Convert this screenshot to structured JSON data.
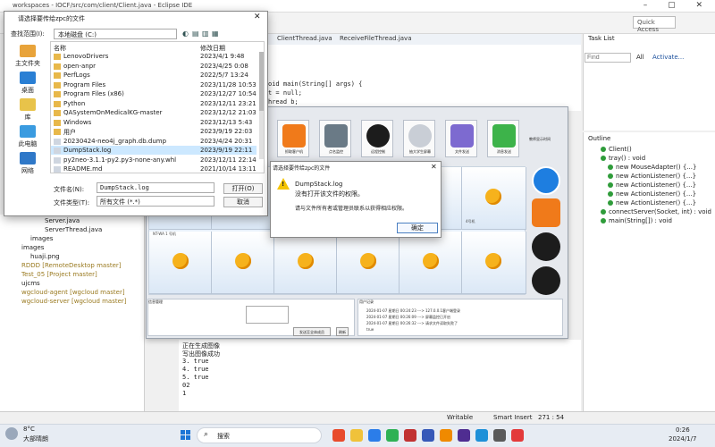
{
  "eclipse": {
    "title": "workspaces - IOCF/src/com/client/Client.java - Eclipse IDE",
    "quick_access": "Quick Access",
    "tabs": [
      "ClientThread.java",
      "ReceiveFileThread.java"
    ],
    "code_lines": [
      "oid main(String[] args) {",
      "t = null;",
      "hread b;"
    ],
    "task_list_title": "Task List",
    "find_placeholder": "Find",
    "find_all": "All",
    "find_activate": "Activate...",
    "outline_title": "Outline",
    "outline_items": [
      "Client()",
      "tray() : void",
      "new MouseAdapter() {...}",
      "new ActionListener() {...}",
      "new ActionListener() {...}",
      "new ActionListener() {...}",
      "new ActionListener() {...}",
      "connectServer(Socket, int) : void",
      "main(String[]) : void"
    ],
    "explorer_items": [
      "Server.java",
      "ServerThread.java",
      "images",
      "images",
      "huaji.png",
      "RDDD [RemoteDesktop master]",
      "Test_05 [Project master]",
      "ujcms",
      "wgcloud-agent [wgcloud master]",
      "wgcloud-server [wgcloud master]"
    ],
    "console_lines": [
      "正在生成图像",
      "写出图像成功",
      "3. true",
      "4. true",
      "5. true",
      "02",
      "1"
    ],
    "status": {
      "writable": "Writable",
      "insert": "Smart Insert",
      "position": "271 : 54"
    }
  },
  "remote_app": {
    "toolbar": [
      "抓取客户机",
      "点名监控",
      "远程控制",
      "抽大学生屏幕",
      "文件发送",
      "消息发送"
    ],
    "side_label": "教师显示时间",
    "cell_label": "NT-WA 1 号机",
    "cell_label_2": "4号机",
    "info_title": "信息管理",
    "notify_button": "发送至全体成员",
    "send_label": "刷新",
    "log_title": "用户记录",
    "log_lines": [
      "2024-01-07 星期日 00:24:23 ---> 127.0.0.1客户端登录",
      "2024-01-07 星期日 00:26:09 ---> 屏幕监控已开启",
      "2024-01-07 星期日 00:26:32 ---> 请求文件读取失败了",
      "true"
    ]
  },
  "file_dialog": {
    "title": "请选择要传给zpc的文件",
    "look_in_label": "查找范围(I):",
    "look_in_value": "本地磁盘 (C:)",
    "places": [
      "主文件夹",
      "桌面",
      "库",
      "此电脑",
      "网络"
    ],
    "col_name": "名称",
    "col_date": "修改日期",
    "files": [
      {
        "name": "LenovoDrivers",
        "date": "2023/4/1 9:48",
        "type": "folder"
      },
      {
        "name": "open-anpr",
        "date": "2023/4/25 0:08",
        "type": "folder"
      },
      {
        "name": "PerfLogs",
        "date": "2022/5/7 13:24",
        "type": "folder"
      },
      {
        "name": "Program Files",
        "date": "2023/11/28 10:53",
        "type": "folder"
      },
      {
        "name": "Program Files (x86)",
        "date": "2023/12/27 10:54",
        "type": "folder"
      },
      {
        "name": "Python",
        "date": "2023/12/11 23:21",
        "type": "folder"
      },
      {
        "name": "QASystemOnMedicalKG-master",
        "date": "2023/12/12 21:03",
        "type": "folder"
      },
      {
        "name": "Windows",
        "date": "2023/12/13 5:43",
        "type": "folder"
      },
      {
        "name": "用户",
        "date": "2023/9/19 22:03",
        "type": "folder"
      },
      {
        "name": "20230424-neo4j_graph.db.dump",
        "date": "2023/4/24 20:31",
        "type": "file"
      },
      {
        "name": "DumpStack.log",
        "date": "2023/9/19 22:11",
        "type": "file",
        "selected": true
      },
      {
        "name": "py2neo-3.1.1-py2.py3-none-any.whl",
        "date": "2023/12/11 22:14",
        "type": "file"
      },
      {
        "name": "README.md",
        "date": "2021/10/14 13:11",
        "type": "file"
      }
    ],
    "file_name_label": "文件名(N):",
    "file_name_value": "DumpStack.log",
    "file_type_label": "文件类型(T):",
    "file_type_value": "所有文件 (*.*)",
    "open_button": "打开(O)",
    "cancel_button": "取消"
  },
  "error_dialog": {
    "title": "请选择要传给zpc的文件",
    "line1": "DumpStack.log",
    "line2": "没有打开该文件的权限。",
    "line3": "请与文件所有者或管理员联系以获得相应权限。",
    "ok_button": "确定"
  },
  "taskbar": {
    "temp": "8°C",
    "weather": "大部晴朗",
    "search": "搜索",
    "time": "0:26",
    "date": "2024/1/7"
  }
}
